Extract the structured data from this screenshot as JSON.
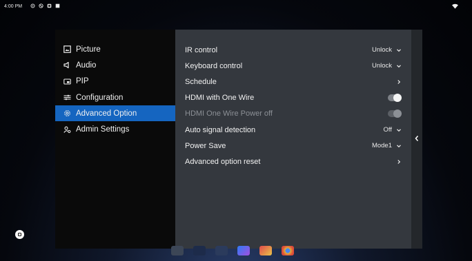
{
  "status_bar": {
    "time": "4:00 PM",
    "icons": [
      "gear-icon",
      "block-icon",
      "notification-icon",
      "square-icon"
    ],
    "wifi_icon": "wifi-icon"
  },
  "sidebar": {
    "items": [
      {
        "label": "Picture",
        "icon": "picture-icon",
        "active": false
      },
      {
        "label": "Audio",
        "icon": "speaker-icon",
        "active": false
      },
      {
        "label": "PIP",
        "icon": "pip-icon",
        "active": false
      },
      {
        "label": "Configuration",
        "icon": "sliders-icon",
        "active": false
      },
      {
        "label": "Advanced Option",
        "icon": "gear-icon",
        "active": true
      },
      {
        "label": "Admin Settings",
        "icon": "admin-icon",
        "active": false
      }
    ]
  },
  "settings": {
    "rows": [
      {
        "label": "IR control",
        "value": "Unlock",
        "control": "dropdown"
      },
      {
        "label": "Keyboard control",
        "value": "Unlock",
        "control": "dropdown"
      },
      {
        "label": "Schedule",
        "value": "",
        "control": "link"
      },
      {
        "label": "HDMI with One Wire",
        "value": "",
        "control": "toggle"
      },
      {
        "label": "HDMI One Wire Power off",
        "value": "",
        "control": "toggle",
        "disabled": true
      },
      {
        "label": "Auto signal detection",
        "value": "Off",
        "control": "dropdown"
      },
      {
        "label": "Power Save",
        "value": "Mode1",
        "control": "dropdown"
      },
      {
        "label": "Advanced option reset",
        "value": "",
        "control": "link"
      }
    ]
  },
  "colors": {
    "accent": "#1565c0",
    "panel": "#34383e",
    "sidebar": "#0a0a0a"
  },
  "dock": {
    "apps": [
      "app-1-icon",
      "folder-icon",
      "settings-icon",
      "play-store-icon",
      "app-grid-icon",
      "chrome-icon"
    ]
  }
}
